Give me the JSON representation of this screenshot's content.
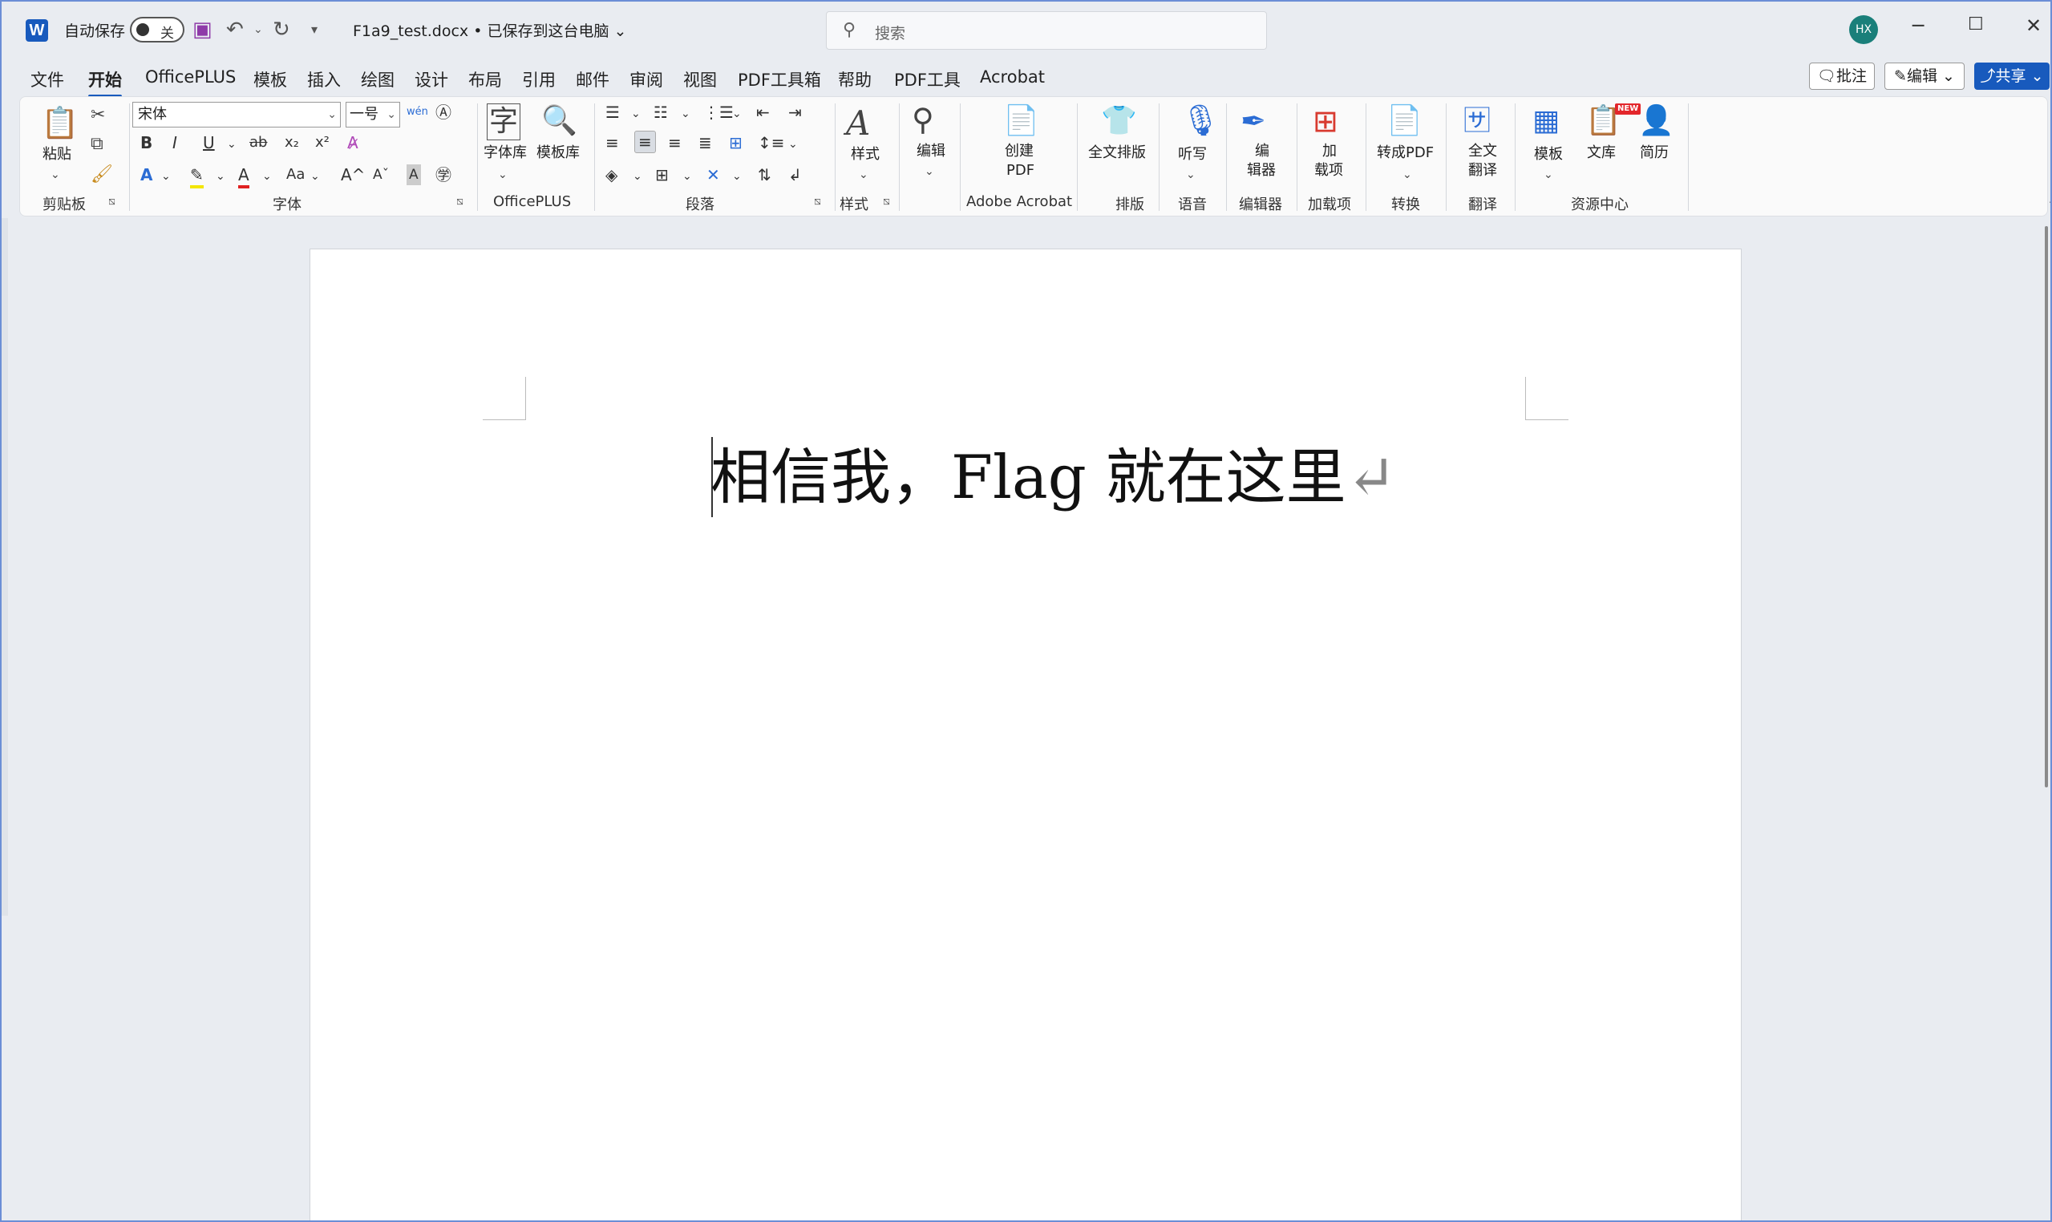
{
  "titlebar": {
    "autosave_label": "自动保存",
    "autosave_state": "关",
    "doc_title": "F1a9_test.docx • 已保存到这台电脑 ⌄",
    "search_placeholder": "搜索",
    "avatar_initials": "HX"
  },
  "tabs": [
    "文件",
    "开始",
    "OfficePLUS",
    "模板",
    "插入",
    "绘图",
    "设计",
    "布局",
    "引用",
    "邮件",
    "审阅",
    "视图",
    "PDF工具箱",
    "帮助",
    "PDF工具",
    "Acrobat"
  ],
  "active_tab": "开始",
  "actions": {
    "comment": "批注",
    "edit": "编辑",
    "share": "共享"
  },
  "ribbon": {
    "clipboard": {
      "paste": "粘贴",
      "group": "剪贴板"
    },
    "font": {
      "font_name": "宋体",
      "font_size": "一号",
      "group": "字体"
    },
    "officeplus": {
      "font_lib": "字体库",
      "template_lib": "模板库",
      "group": "OfficePLUS"
    },
    "paragraph": {
      "group": "段落"
    },
    "styles": {
      "label": "样式",
      "group": "样式"
    },
    "editing": {
      "label": "编辑"
    },
    "acrobat": {
      "create_pdf": "创建\nPDF",
      "create_pdf_l1": "创建",
      "create_pdf_l2": "PDF",
      "group": "Adobe Acrobat"
    },
    "layout": {
      "label": "全文排版",
      "group": "排版"
    },
    "voice": {
      "label": "听写",
      "group": "语音"
    },
    "editor": {
      "l1": "编",
      "l2": "辑器",
      "group": "编辑器"
    },
    "addins": {
      "l1": "加",
      "l2": "载项",
      "group": "加载项"
    },
    "convert": {
      "label": "转成PDF",
      "group": "转换"
    },
    "translate": {
      "l1": "全文",
      "l2": "翻译",
      "group": "翻译"
    },
    "resources": {
      "template": "模板",
      "library": "文库",
      "resume": "简历",
      "new_badge": "NEW",
      "group": "资源中心"
    }
  },
  "document": {
    "text": "相信我，Flag 就在这里",
    "paragraph_mark": "↵"
  }
}
